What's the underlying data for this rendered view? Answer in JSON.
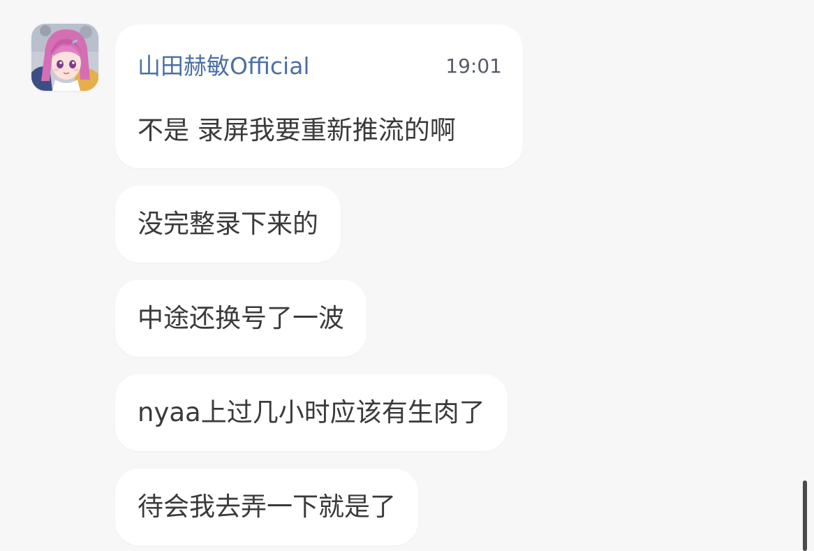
{
  "chat": {
    "sender_name": "山田赫敏Official",
    "first_message_time": "19:01",
    "avatar_icon": "anime-girl-avatar-icon",
    "messages": [
      {
        "text": "不是 录屏我要重新推流的啊"
      },
      {
        "text": "没完整录下来的"
      },
      {
        "text": "中途还换号了一波"
      },
      {
        "text": "nyaa上过几小时应该有生肉了"
      },
      {
        "text": "待会我去弄一下就是了"
      }
    ]
  },
  "colors": {
    "background": "#f7f7f8",
    "bubble": "#ffffff",
    "sender_name": "#4a6fa5",
    "message_text": "#3a3a3a",
    "time_text": "#555b66",
    "scrollbar": "#4a4a4a"
  }
}
